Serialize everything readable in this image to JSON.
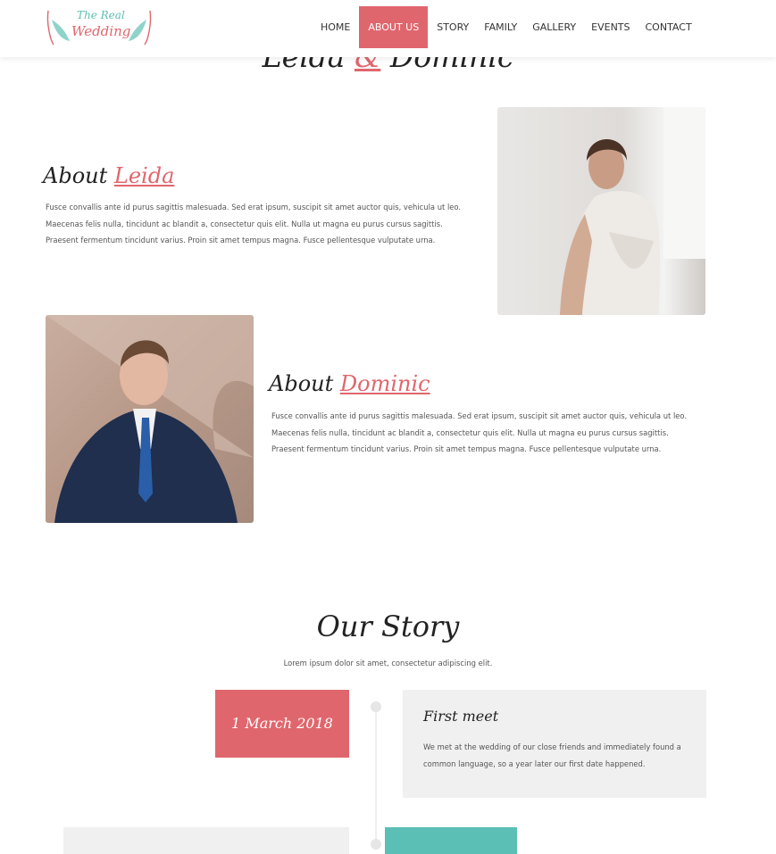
{
  "logo": {
    "line1": "The Real",
    "line2": "Wedding"
  },
  "nav": {
    "items": [
      {
        "label": "HOME"
      },
      {
        "label": "ABOUT US",
        "active": true
      },
      {
        "label": "STORY"
      },
      {
        "label": "FAMILY"
      },
      {
        "label": "GALLERY"
      },
      {
        "label": "EVENTS"
      },
      {
        "label": "CONTACT"
      }
    ]
  },
  "hero": {
    "name1": "Leida",
    "amp": "&",
    "name2": "Dominic"
  },
  "about_leida": {
    "prefix": "About",
    "name": "Leida",
    "lines": [
      "Fusce convallis ante id purus sagittis malesuada. Sed erat ipsum, suscipit sit amet auctor quis, vehicula ut leo.",
      "Maecenas felis nulla, tincidunt ac blandit a, consectetur quis elit. Nulla ut magna eu purus cursus sagittis.",
      "Praesent fermentum tincidunt varius. Proin sit amet tempus magna. Fusce pellentesque vulputate urna."
    ]
  },
  "about_dominic": {
    "prefix": "About",
    "name": "Dominic",
    "lines": [
      "Fusce convallis ante id purus sagittis malesuada. Sed erat ipsum, suscipit sit amet auctor quis, vehicula ut leo.",
      "Maecenas felis nulla, tincidunt ac blandit a, consectetur quis elit. Nulla ut magna eu purus cursus sagittis.",
      "Praesent fermentum tincidunt varius. Proin sit amet tempus magna. Fusce pellentesque vulputate urna."
    ]
  },
  "story": {
    "title": "Our Story",
    "subtitle": "Lorem ipsum dolor sit amet, consectetur adipiscing elit.",
    "events": [
      {
        "date": "1 March 2018",
        "title": "First meet",
        "text": "We met at the wedding of our close friends and immediately found a common language, so a year later our first date happened."
      }
    ]
  },
  "colors": {
    "accent": "#e0666d",
    "teal": "#5bbfb5",
    "card_bg": "#f0f0f0"
  }
}
